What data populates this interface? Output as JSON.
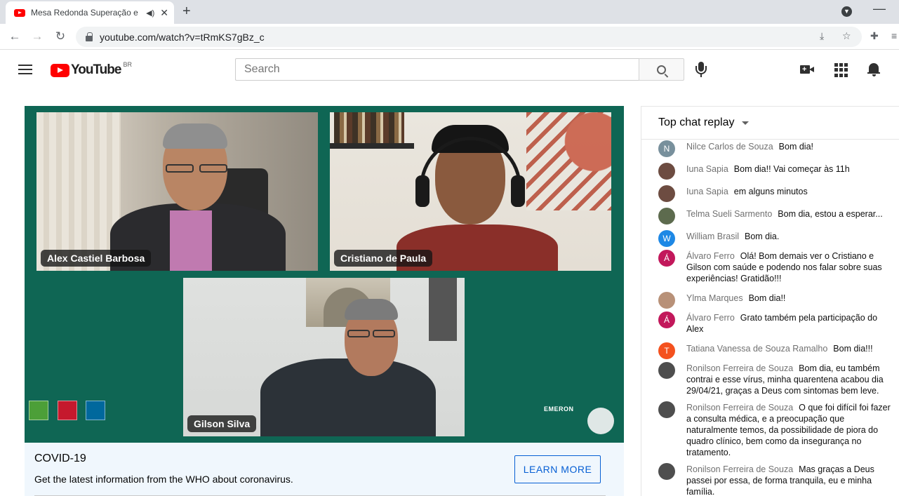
{
  "browser": {
    "tab_title": "Mesa Redonda Superação e",
    "url": "youtube.com/watch?v=tRmKS7gBz_c"
  },
  "youtube": {
    "logo_text": "YouTube",
    "country_code": "BR",
    "search_placeholder": "Search"
  },
  "video": {
    "participants": [
      "Alex Castiel Barbosa",
      "Cristiano de Paula",
      "Gilson Silva"
    ],
    "watermark": "EMERON"
  },
  "banner": {
    "heading": "COVID-19",
    "text": "Get the latest information from the WHO about coronavirus.",
    "button": "LEARN MORE"
  },
  "chat": {
    "header": "Top chat replay",
    "messages": [
      {
        "author": "Nilce Carlos de Souza",
        "text": "Bom dia!",
        "initial": "N",
        "color": "#78909c"
      },
      {
        "author": "Iuna Sapia",
        "text": "Bom dia!! Vai começar às 11h",
        "initial": "",
        "color": "#6d4c41"
      },
      {
        "author": "Iuna Sapia",
        "text": "em alguns minutos",
        "initial": "",
        "color": "#6d4c41"
      },
      {
        "author": "Telma Sueli Sarmento",
        "text": "Bom dia, estou a esperar...",
        "initial": "",
        "color": "#5d6b4e"
      },
      {
        "author": "William Brasil",
        "text": "Bom dia.",
        "initial": "W",
        "color": "#1e88e5"
      },
      {
        "author": "Álvaro Ferro",
        "text": "Olá! Bom demais ver o Cristiano e Gilson com saúde e podendo nos falar sobre suas experiências! Gratidão!!!",
        "initial": "Á",
        "color": "#c2185b"
      },
      {
        "author": "Ylma Marques",
        "text": "Bom dia!!",
        "initial": "",
        "color": "#b89178"
      },
      {
        "author": "Álvaro Ferro",
        "text": "Grato também pela participação do Alex",
        "initial": "Á",
        "color": "#c2185b"
      },
      {
        "author": "Tatiana Vanessa de Souza Ramalho",
        "text": "Bom dia!!!",
        "initial": "T",
        "color": "#f4511e"
      },
      {
        "author": "Ronilson Ferreira de Souza",
        "text": "Bom dia, eu também contrai e esse vírus, minha quarentena acabou dia 29/04/21, graças a Deus com sintomas bem leve.",
        "initial": "",
        "color": "#4e4e4e"
      },
      {
        "author": "Ronilson Ferreira de Souza",
        "text": "O que foi difícil foi fazer a consulta médica, e a preocupação que naturalmente temos, da possibilidade de piora do quadro clínico, bem como da insegurança no tratamento.",
        "initial": "",
        "color": "#4e4e4e"
      },
      {
        "author": "Ronilson Ferreira de Souza",
        "text": "Mas graças a Deus passei por essa, de forma tranquila, eu e minha família.",
        "initial": "",
        "color": "#4e4e4e"
      }
    ]
  }
}
